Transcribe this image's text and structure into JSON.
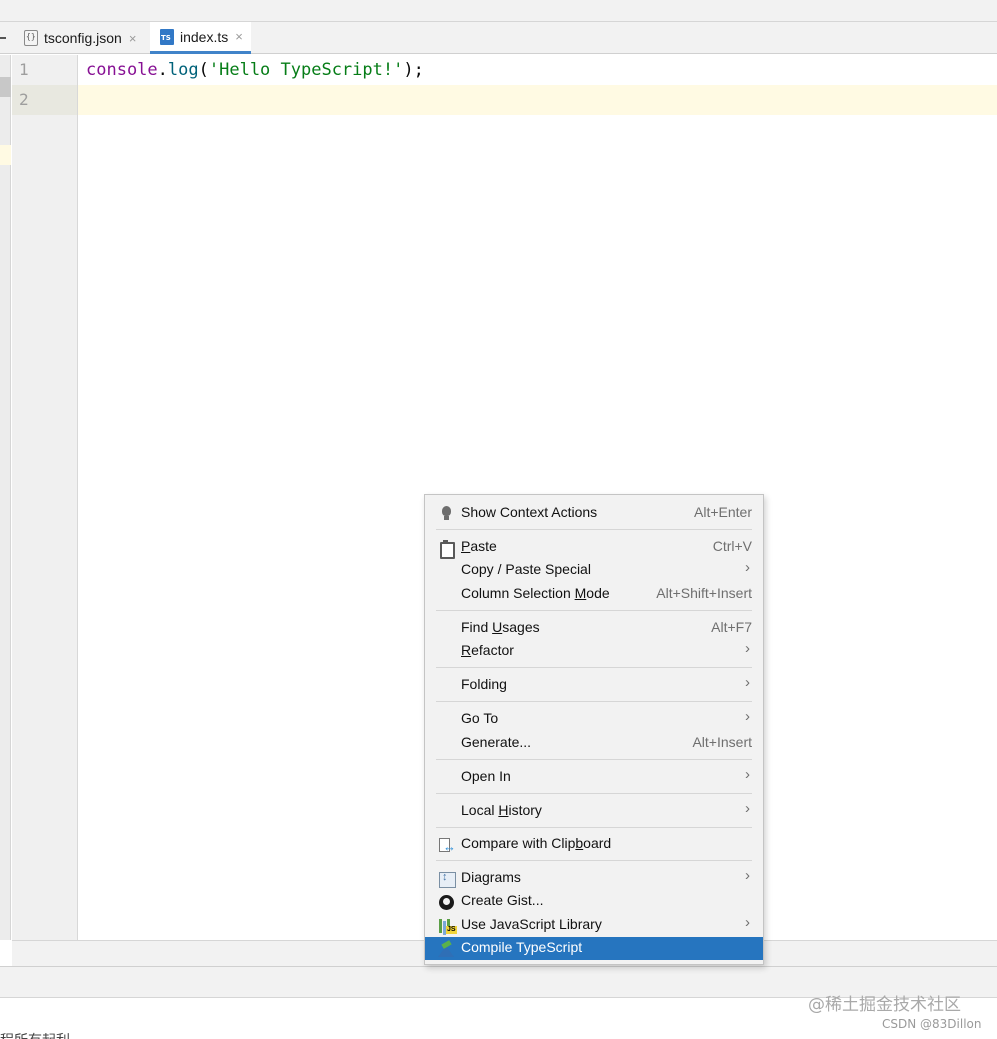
{
  "tabs": [
    {
      "label": "tsconfig.json",
      "icon": "json-file-icon",
      "active": false,
      "close": "×"
    },
    {
      "label": "index.ts",
      "icon": "typescript-file-icon",
      "active": true,
      "close": "×"
    }
  ],
  "editor": {
    "line_numbers": [
      "1",
      "2"
    ],
    "code_line_1": {
      "object": "console",
      "dot": ".",
      "method": "log",
      "open_paren": "(",
      "string": "'Hello TypeScript!'",
      "close": ");"
    }
  },
  "context_menu": {
    "items": [
      {
        "id": "show_context_actions",
        "pre": "Show Context Actions",
        "mnemonic": "",
        "post": "",
        "shortcut": "Alt+Enter",
        "icon": "bulb-icon",
        "submenu": false
      },
      {
        "id": "paste",
        "pre": "",
        "mnemonic": "P",
        "post": "aste",
        "shortcut": "Ctrl+V",
        "icon": "clipboard-icon",
        "submenu": false
      },
      {
        "id": "copy_paste_special",
        "pre": "Copy / Paste Special",
        "mnemonic": "",
        "post": "",
        "shortcut": "",
        "icon": "",
        "submenu": true
      },
      {
        "id": "column_selection_mode",
        "pre": "Column Selection ",
        "mnemonic": "M",
        "post": "ode",
        "shortcut": "Alt+Shift+Insert",
        "icon": "",
        "submenu": false
      },
      {
        "id": "find_usages",
        "pre": "Find ",
        "mnemonic": "U",
        "post": "sages",
        "shortcut": "Alt+F7",
        "icon": "",
        "submenu": false
      },
      {
        "id": "refactor",
        "pre": "",
        "mnemonic": "R",
        "post": "efactor",
        "shortcut": "",
        "icon": "",
        "submenu": true
      },
      {
        "id": "folding",
        "pre": "Folding",
        "mnemonic": "",
        "post": "",
        "shortcut": "",
        "icon": "",
        "submenu": true
      },
      {
        "id": "go_to",
        "pre": "Go To",
        "mnemonic": "",
        "post": "",
        "shortcut": "",
        "icon": "",
        "submenu": true
      },
      {
        "id": "generate",
        "pre": "Generate...",
        "mnemonic": "",
        "post": "",
        "shortcut": "Alt+Insert",
        "icon": "",
        "submenu": false
      },
      {
        "id": "open_in",
        "pre": "Open In",
        "mnemonic": "",
        "post": "",
        "shortcut": "",
        "icon": "",
        "submenu": true
      },
      {
        "id": "local_history",
        "pre": "Local ",
        "mnemonic": "H",
        "post": "istory",
        "shortcut": "",
        "icon": "",
        "submenu": true
      },
      {
        "id": "compare_with_clipboard",
        "pre": "Compare with Clip",
        "mnemonic": "b",
        "post": "oard",
        "shortcut": "",
        "icon": "compare-icon",
        "submenu": false
      },
      {
        "id": "diagrams",
        "pre": "Diagrams",
        "mnemonic": "",
        "post": "",
        "shortcut": "",
        "icon": "diagram-icon",
        "submenu": true
      },
      {
        "id": "create_gist",
        "pre": "Create Gist...",
        "mnemonic": "",
        "post": "",
        "shortcut": "",
        "icon": "github-icon",
        "submenu": false
      },
      {
        "id": "use_javascript_library",
        "pre": "Use JavaScript Library",
        "mnemonic": "",
        "post": "",
        "shortcut": "",
        "icon": "jslib-icon",
        "submenu": true
      },
      {
        "id": "compile_typescript",
        "pre": "Compile TypeScript",
        "mnemonic": "",
        "post": "",
        "shortcut": "",
        "icon": "ts-compile-icon",
        "submenu": false,
        "selected": true
      }
    ],
    "submenu_arrow": "›"
  },
  "watermark": {
    "juejin": "@稀土掘金技术社区",
    "csdn": "CSDN @83Dillon"
  },
  "bottom_cut_text": "程所有起利",
  "colors": {
    "selection": "#2675bf",
    "current_line": "#fffae3",
    "tab_underline": "#4083c9"
  }
}
